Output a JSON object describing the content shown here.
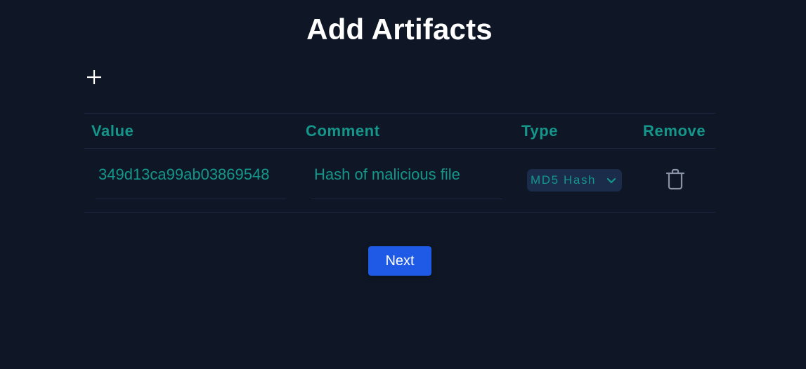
{
  "page": {
    "title": "Add Artifacts"
  },
  "toolbar": {
    "add_icon": "plus-icon"
  },
  "table": {
    "columns": [
      "Value",
      "Comment",
      "Type",
      "Remove"
    ],
    "rows": [
      {
        "value": "349d13ca99ab03869548",
        "comment": "Hash of malicious file",
        "type": "MD5 Hash",
        "remove_icon": "trash-icon"
      }
    ]
  },
  "actions": {
    "next_label": "Next"
  },
  "colors": {
    "background": "#0f1726",
    "accent_teal": "#14968a",
    "primary_button": "#1e5ae6",
    "select_bg": "#1b2b4a",
    "divider": "#1c2640",
    "icon_gray": "#8a92a6"
  }
}
